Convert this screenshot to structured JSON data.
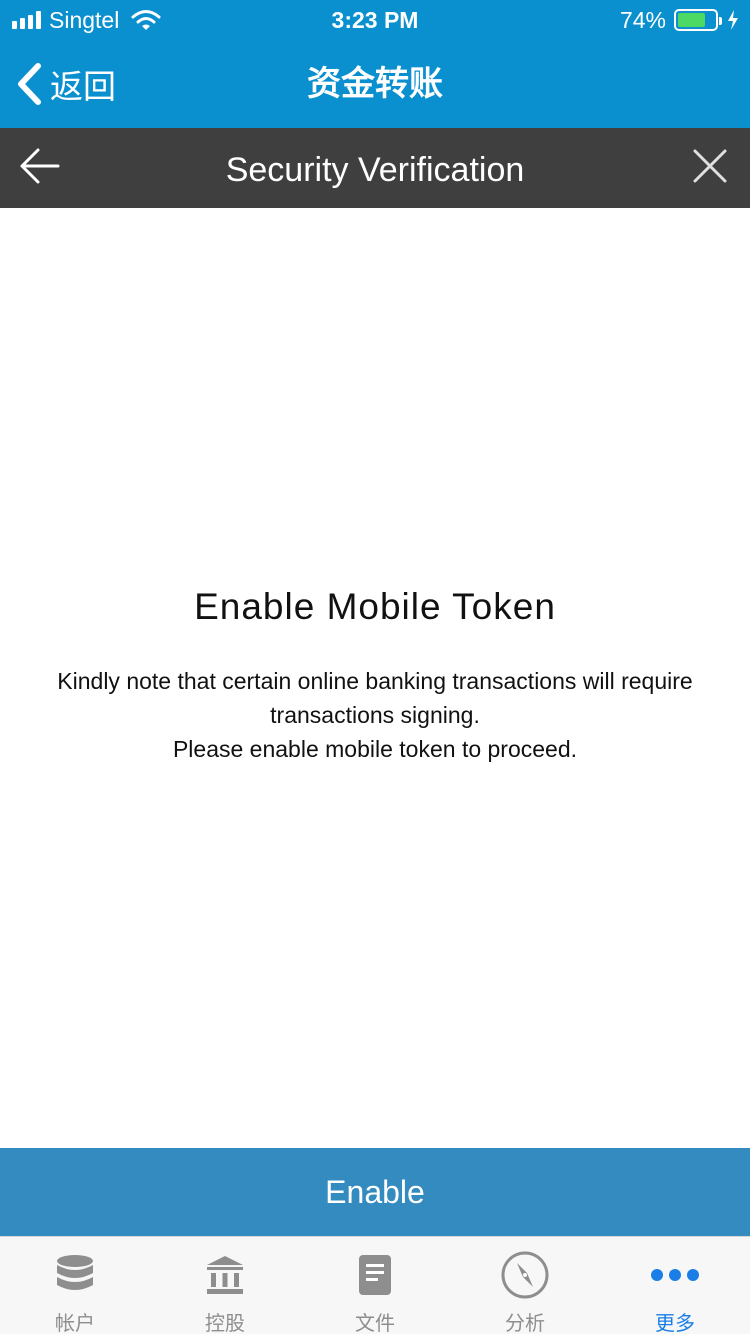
{
  "status_bar": {
    "carrier": "Singtel",
    "time": "3:23 PM",
    "battery_percent": "74%",
    "battery_level": 0.74,
    "icons": [
      "signal-icon",
      "wifi-icon",
      "battery-icon",
      "charging-icon"
    ]
  },
  "nav": {
    "back_label": "返回",
    "title": "资金转账",
    "color": "#0a8fcf"
  },
  "verification": {
    "title": "Security Verification",
    "back_icon": "arrow-left-icon",
    "close_icon": "close-icon"
  },
  "content": {
    "heading": "Enable Mobile Token",
    "line1": "Kindly note that certain online banking transactions will require transactions signing.",
    "line2": "Please enable mobile token to proceed."
  },
  "enable_button": {
    "label": "Enable",
    "color": "#338bbf"
  },
  "tabs": [
    {
      "label": "帐户",
      "icon": "database-icon",
      "active": false
    },
    {
      "label": "控股",
      "icon": "bank-icon",
      "active": false
    },
    {
      "label": "文件",
      "icon": "document-icon",
      "active": false
    },
    {
      "label": "分析",
      "icon": "compass-icon",
      "active": false
    },
    {
      "label": "更多",
      "icon": "more-icon",
      "active": true
    }
  ],
  "colors": {
    "accent": "#1a7ee6",
    "header_dark": "#3f3f3f"
  }
}
